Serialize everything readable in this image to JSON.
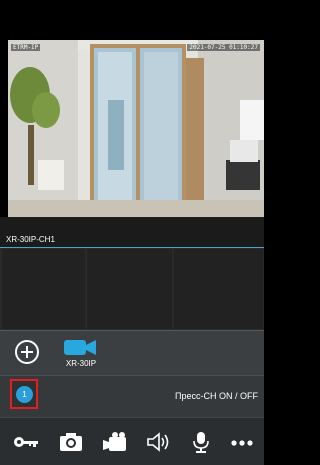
{
  "camera": {
    "overlay_left": "ETRM-IP",
    "overlay_timestamp": "2021-07-25 01:10:27",
    "channel_label": "XR-30IP-CH1"
  },
  "device": {
    "label": "XR-30IP",
    "icon": "video-camera-icon",
    "accent_color": "#29a8e0"
  },
  "status": {
    "channel_number": "1",
    "press_label": "Пресс-CH ON / OFF",
    "badge_border_color": "#e02020"
  },
  "toolbar": {
    "icons": [
      "key-icon",
      "camera-icon",
      "video-record-icon",
      "speaker-icon",
      "microphone-icon",
      "more-icon"
    ]
  }
}
